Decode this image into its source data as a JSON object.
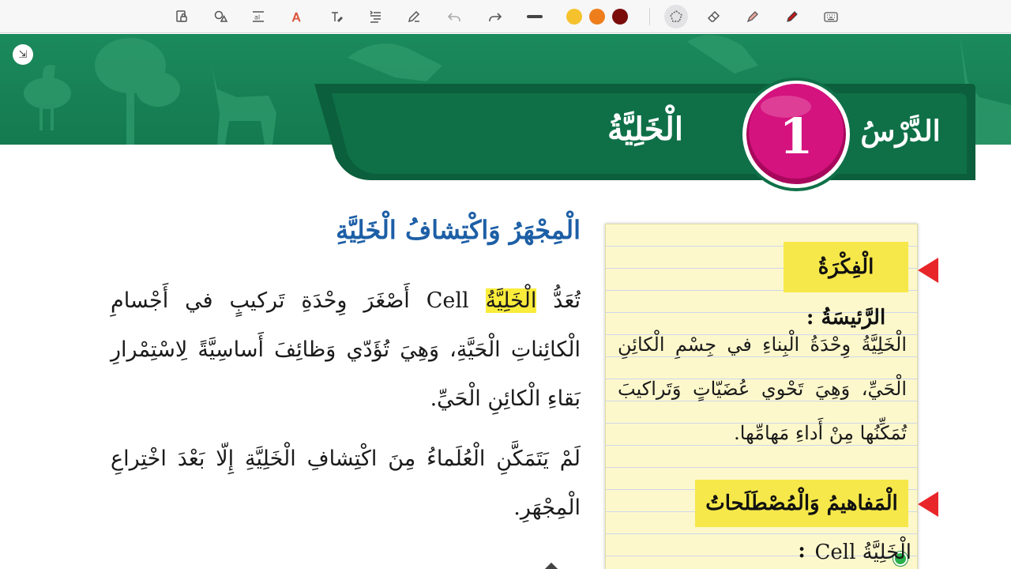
{
  "toolbar": {
    "tools": [
      "select-lock-icon",
      "shapes-icon",
      "text-size-icon",
      "text-style-icon",
      "text-icon",
      "line-spacing-icon",
      "pen-edit-icon",
      "undo-icon",
      "redo-icon",
      "line-thickness-icon"
    ],
    "colors": [
      "#f5c22e",
      "#ee7d1c",
      "#7a0c0c"
    ],
    "right_tools": [
      "lasso-icon",
      "eraser-icon",
      "highlighter-icon",
      "marker-icon",
      "keyboard-icon"
    ]
  },
  "banner": {
    "lesson_word": "الدَّرْسُ",
    "lesson_number": "1",
    "lesson_title": "الْخَلِيَّةُ",
    "colors": {
      "banner": "#1b8a5c",
      "ribbon": "#0f7048",
      "badge": "#d4137f"
    }
  },
  "content": {
    "heading": "الْمِجْهَرُ وَاكْتِشافُ الْخَلِيَّةِ",
    "p1": {
      "before": "تُعَدُّ ",
      "highlight": "الْخَلِيَّةُ",
      "after": " Cell أَصْغَرَ وِحْدَةِ تَركيبٍ في أَجْسامِ الْكائِناتِ الْحَيَّةِ، وَهِيَ تُؤَدّي وَظائِفَ أَساسِيَّةً لِاسْتِمْرارِ بَقاءِ الْكائِنِ الْحَيِّ."
    },
    "p2": "لَمْ يَتَمَكَّنِ الْعُلَماءُ مِنَ اكْتِشافِ الْخَلِيَّةِ إِلّا بَعْدَ اخْتِراعِ الْمِجْهَرِ."
  },
  "note": {
    "main_idea_label": "الْفِكْرَةُ الرَّئيسَةُ :",
    "main_idea_text": "الْخَلِيَّةُ وِحْدَةُ الْبِناءِ في جِسْمِ الْكائِنِ الْحَيِّ، وَهِيَ تَحْوي عُضَيّاتٍ وَتَراكيبَ تُمَكِّنُها مِنْ أَداءِ مَهامِّها.",
    "concepts_label": "الْمَفاهيمُ وَالْمُصْطَلَحاتُ :",
    "term_1": "الْخَلِيَّةُ Cell"
  }
}
